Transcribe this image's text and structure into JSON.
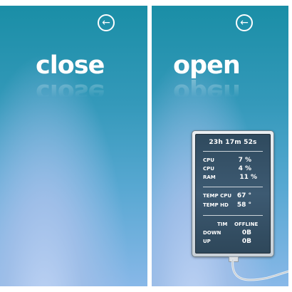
{
  "left_panel": {
    "title": "close",
    "back_icon": "arrow-left-circle-icon"
  },
  "right_panel": {
    "title": "open",
    "back_icon": "arrow-left-circle-icon",
    "widget": {
      "uptime": "23h 17m 52s",
      "stats": [
        {
          "label": "CPU",
          "value": "7 %"
        },
        {
          "label": "CPU",
          "value": "4 %"
        },
        {
          "label": "RAM",
          "value": "11 %"
        }
      ],
      "temps": [
        {
          "label": "TEMP CPU",
          "value": "67 °"
        },
        {
          "label": "TEMP HD",
          "value": "58 °"
        }
      ],
      "network": {
        "name": "TIM",
        "status": "OFFLINE",
        "rows": [
          {
            "label": "DOWN",
            "value": "0B"
          },
          {
            "label": "UP",
            "value": "0B"
          }
        ]
      }
    }
  }
}
